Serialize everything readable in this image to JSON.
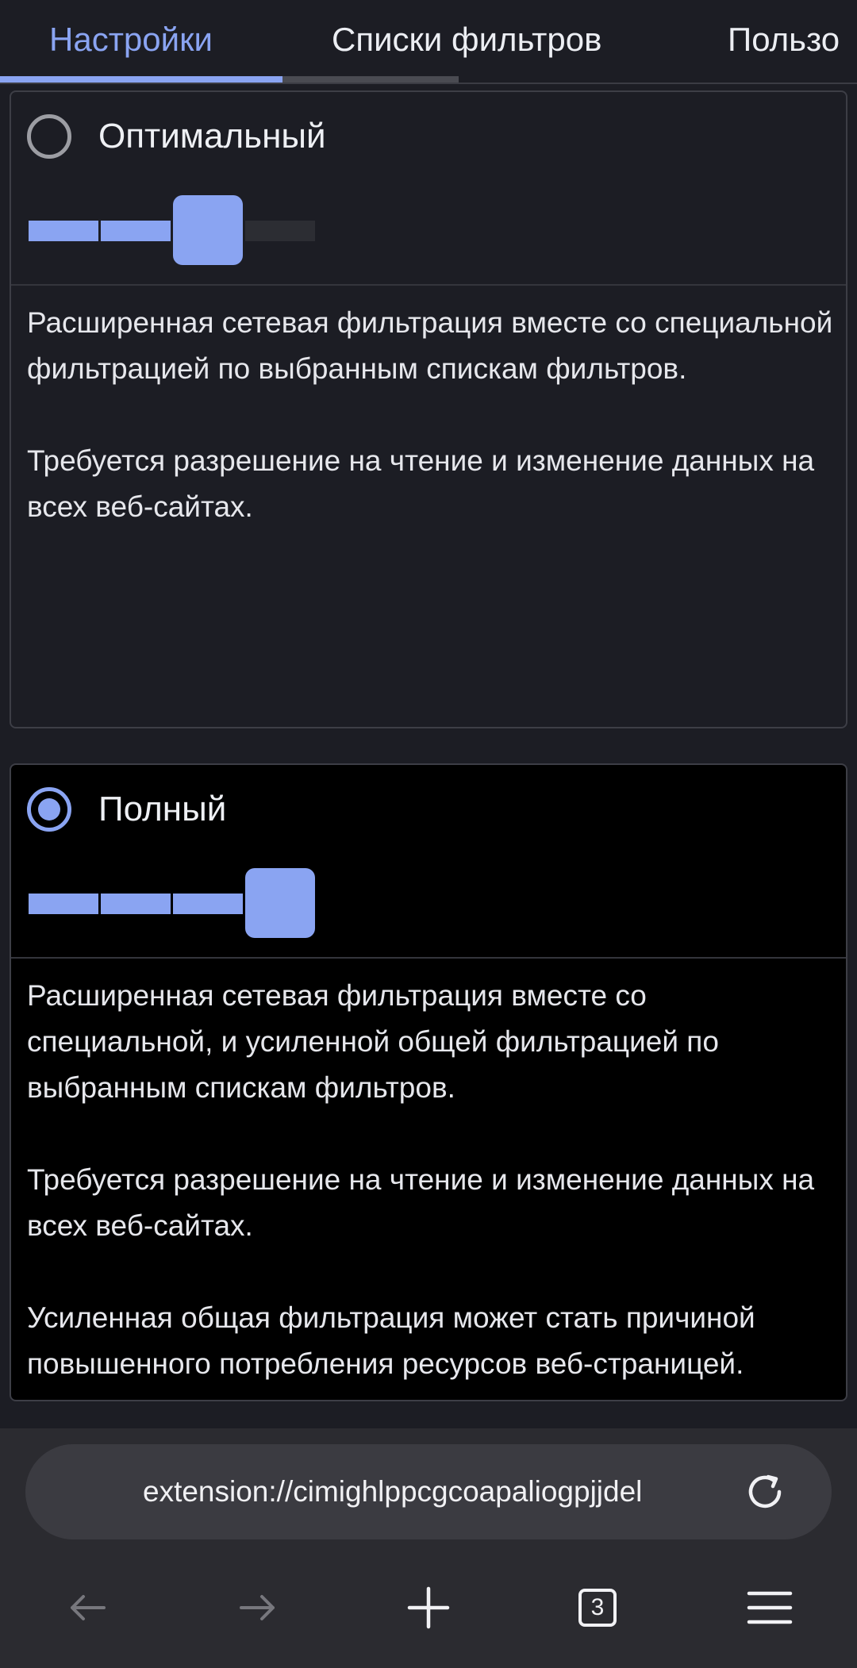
{
  "tabs": [
    {
      "label": "Настройки",
      "active": true
    },
    {
      "label": "Списки фильтров",
      "active": false
    },
    {
      "label": "Пользо",
      "active": false
    }
  ],
  "modes": [
    {
      "title": "Оптимальный",
      "selected": false,
      "level": 3,
      "level_max": 4,
      "description": [
        "Расширенная сетевая фильтрация вместе со специальной фильтрацией по выбранным спискам фильтров.",
        "Требуется разрешение на чтение и изменение данных на всех веб-сайтах."
      ]
    },
    {
      "title": "Полный",
      "selected": true,
      "level": 4,
      "level_max": 4,
      "description": [
        "Расширенная сетевая фильтрация вместе со специальной, и усиленной общей фильтрацией по выбранным спискам фильтров.",
        "Требуется разрешение на чтение и изменение данных на всех веб-сайтах.",
        "Усиленная общая фильтрация может стать причиной повышенного потребления ресурсов веб-страницей."
      ]
    }
  ],
  "browser": {
    "url": "extension://cimighlppcgcoapaliogpjjdel",
    "tab_count": "3",
    "icons": {
      "reload": "reload-icon",
      "back": "back-arrow-icon",
      "forward": "forward-arrow-icon",
      "new_tab": "plus-icon",
      "tabs": "tab-switcher-icon",
      "menu": "hamburger-menu-icon"
    }
  },
  "colors": {
    "accent": "#8aa4f2",
    "background": "#1c1d24",
    "selected_card": "#000000",
    "chrome": "#2b2b30"
  }
}
